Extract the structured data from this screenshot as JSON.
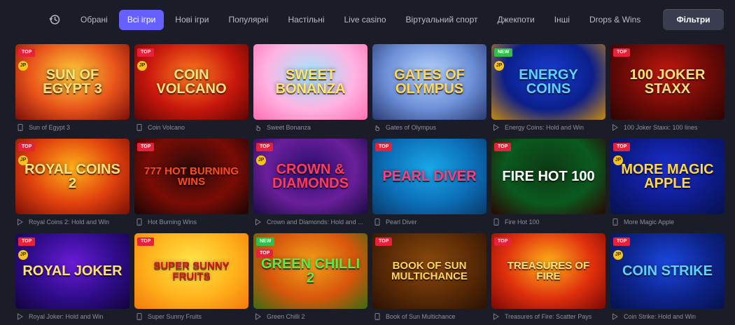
{
  "tabs": [
    {
      "label": "Обрані",
      "active": false
    },
    {
      "label": "Всі ігри",
      "active": true
    },
    {
      "label": "Нові ігри",
      "active": false
    },
    {
      "label": "Популярні",
      "active": false
    },
    {
      "label": "Настільні",
      "active": false
    },
    {
      "label": "Live casino",
      "active": false
    },
    {
      "label": "Віртуальний спорт",
      "active": false
    },
    {
      "label": "Джекпоти",
      "active": false
    },
    {
      "label": "Інші",
      "active": false
    },
    {
      "label": "Drops & Wins",
      "active": false
    }
  ],
  "filters_label": "Фільтри",
  "colors": {
    "accent": "#6560ff",
    "background": "#1a1c27",
    "top_badge": "#e8213a",
    "new_badge": "#2fbf4a",
    "jp_badge": "#f4c21c"
  },
  "games": [
    {
      "name": "Sun of Egypt 3",
      "art": "SUN OF EGYPT 3",
      "badges": [
        "TOP",
        "JP"
      ],
      "icon": "phone-icon",
      "bg": [
        "#ffcf3a",
        "#e8521a",
        "#7a0f08"
      ],
      "art_color": "#ffe27a"
    },
    {
      "name": "Coin Volcano",
      "art": "COIN VOLCANO",
      "badges": [
        "TOP",
        "JP"
      ],
      "icon": "phone-icon",
      "bg": [
        "#ff7a1f",
        "#c8170c",
        "#5c0603"
      ],
      "art_color": "#ffe27a"
    },
    {
      "name": "Sweet Bonanza",
      "art": "SWEET BONANZA",
      "badges": [],
      "icon": "hand-icon",
      "bg": [
        "#9fe9ff",
        "#ffb3e3",
        "#ff6fb0"
      ],
      "art_color": "#ffe36b"
    },
    {
      "name": "Gates of Olympus",
      "art": "GATES OF OLYMPUS",
      "badges": [],
      "icon": "hand-icon",
      "bg": [
        "#b9d6ff",
        "#6b8ed6",
        "#2b3a73"
      ],
      "art_color": "#ffd45a"
    },
    {
      "name": "Energy Coins: Hold and Win",
      "art": "ENERGY COINS",
      "badges": [
        "NEW",
        "JP"
      ],
      "icon": "play-icon",
      "bg": [
        "#1a3fd8",
        "#0b1f8a",
        "#c98a10"
      ],
      "art_color": "#5fd3ff"
    },
    {
      "name": "100 Joker Staxx: 100 lines",
      "art": "100 JOKER STAXX",
      "badges": [
        "TOP"
      ],
      "icon": "play-icon",
      "bg": [
        "#c8180f",
        "#6b0a07",
        "#2a0503"
      ],
      "art_color": "#ffe27a"
    },
    {
      "name": "Royal Coins 2: Hold and Win",
      "art": "ROYAL COINS 2",
      "badges": [
        "TOP",
        "JP"
      ],
      "icon": "play-icon",
      "bg": [
        "#ffb319",
        "#e0400d",
        "#7a0f05"
      ],
      "art_color": "#ffe27a"
    },
    {
      "name": "Hot Burning Wins",
      "art": "777 HOT BURNING WINS",
      "badges": [
        "TOP"
      ],
      "icon": "phone-icon",
      "bg": [
        "#2a0a08",
        "#7a0c06",
        "#1a0504"
      ],
      "art_color": "#ff4d1a"
    },
    {
      "name": "Crown and Diamonds: Hold and ...",
      "art": "CROWN & DIAMONDS",
      "badges": [
        "TOP",
        "JP"
      ],
      "icon": "play-icon",
      "bg": [
        "#2a0f6e",
        "#6a1f9a",
        "#1a0b45"
      ],
      "art_color": "#ff3b5a"
    },
    {
      "name": "Pearl Diver",
      "art": "PEARL DIVER",
      "badges": [
        "TOP"
      ],
      "icon": "phone-icon",
      "bg": [
        "#19a9e8",
        "#0c6fb8",
        "#093a6b"
      ],
      "art_color": "#ff3d7a"
    },
    {
      "name": "Fire Hot 100",
      "art": "FIRE HOT 100",
      "badges": [
        "TOP"
      ],
      "icon": "phone-icon",
      "bg": [
        "#0d3a14",
        "#0a5a1f",
        "#2a0503"
      ],
      "art_color": "#ffffff"
    },
    {
      "name": "More Magic Apple",
      "art": "MORE MAGIC APPLE",
      "badges": [
        "TOP",
        "JP"
      ],
      "icon": "phone-icon",
      "bg": [
        "#1b2fd0",
        "#0d1b8a",
        "#06114d"
      ],
      "art_color": "#ffd54a"
    },
    {
      "name": "Royal Joker: Hold and Win",
      "art": "ROYAL JOKER",
      "badges": [
        "TOP",
        "JP"
      ],
      "icon": "play-icon",
      "bg": [
        "#6a1bd8",
        "#2f0c8a",
        "#12043d"
      ],
      "art_color": "#ffe27a"
    },
    {
      "name": "Super Sunny Fruits",
      "art": "SUPER SUNNY FRUITS",
      "badges": [
        "TOP"
      ],
      "icon": "phone-icon",
      "bg": [
        "#ffe84a",
        "#ffb21c",
        "#f37a0c"
      ],
      "art_color": "#d4141a"
    },
    {
      "name": "Green Chilli 2",
      "art": "GREEN CHILLI 2",
      "badges": [
        "NEW",
        "TOP"
      ],
      "icon": "play-icon",
      "bg": [
        "#f3a21a",
        "#d8560c",
        "#3a6b12"
      ],
      "art_color": "#5fe84a"
    },
    {
      "name": "Book of Sun Multichance",
      "art": "BOOK OF SUN MULTICHANCE",
      "badges": [
        "TOP"
      ],
      "icon": "phone-icon",
      "bg": [
        "#8a4a0c",
        "#5a2a06",
        "#2a1203"
      ],
      "art_color": "#ffd45a"
    },
    {
      "name": "Treasures of Fire: Scatter Pays",
      "art": "TREASURES OF FIRE",
      "badges": [
        "TOP"
      ],
      "icon": "play-icon",
      "bg": [
        "#ffb319",
        "#e0300d",
        "#7a0805"
      ],
      "art_color": "#ffe27a"
    },
    {
      "name": "Coin Strike: Hold and Win",
      "art": "COIN STRIKE",
      "badges": [
        "TOP",
        "JP"
      ],
      "icon": "play-icon",
      "bg": [
        "#1b47e0",
        "#0d238a",
        "#06114d"
      ],
      "art_color": "#5fd3ff"
    }
  ]
}
